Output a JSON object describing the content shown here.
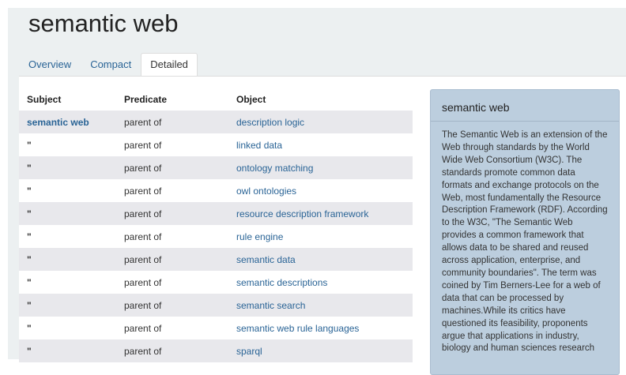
{
  "page": {
    "title": "semantic web"
  },
  "tabs": [
    {
      "label": "Overview",
      "active": false
    },
    {
      "label": "Compact",
      "active": false
    },
    {
      "label": "Detailed",
      "active": true
    }
  ],
  "table": {
    "headers": [
      "Subject",
      "Predicate",
      "Object"
    ],
    "rows": [
      {
        "subject": "semantic web",
        "predicate": "parent of",
        "object": "description logic"
      },
      {
        "subject": "\"",
        "predicate": "parent of",
        "object": "linked data"
      },
      {
        "subject": "\"",
        "predicate": "parent of",
        "object": "ontology matching"
      },
      {
        "subject": "\"",
        "predicate": "parent of",
        "object": "owl ontologies"
      },
      {
        "subject": "\"",
        "predicate": "parent of",
        "object": "resource description framework"
      },
      {
        "subject": "\"",
        "predicate": "parent of",
        "object": "rule engine"
      },
      {
        "subject": "\"",
        "predicate": "parent of",
        "object": "semantic data"
      },
      {
        "subject": "\"",
        "predicate": "parent of",
        "object": "semantic descriptions"
      },
      {
        "subject": "\"",
        "predicate": "parent of",
        "object": "semantic search"
      },
      {
        "subject": "\"",
        "predicate": "parent of",
        "object": "semantic web rule languages"
      },
      {
        "subject": "\"",
        "predicate": "parent of",
        "object": "sparql"
      }
    ]
  },
  "panel": {
    "title": "semantic web",
    "body": "The Semantic Web is an extension of the Web through standards by the World Wide Web Consortium (W3C). The standards promote common data formats and exchange protocols on the Web, most fundamentally the Resource Description Framework (RDF). According to the W3C, \"The Semantic Web provides a common framework that allows data to be shared and reused across application, enterprise, and community boundaries\". The term was coined by Tim Berners-Lee for a web of data that can be processed by machines.While its critics have questioned its feasibility, proponents argue that applications in industry, biology and human sciences research"
  },
  "colors": {
    "link": "#2a6496",
    "page_band": "#ecf0f1",
    "stripe": "#e8e8ec",
    "panel_bg": "#bccede"
  }
}
